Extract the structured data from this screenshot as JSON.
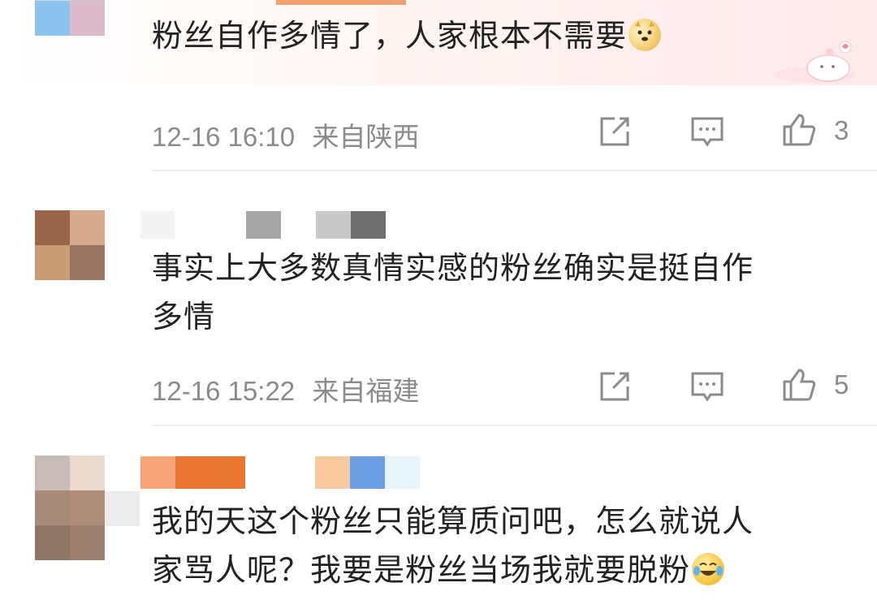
{
  "comments": [
    {
      "text": "粉丝自作多情了，人家根本不需要",
      "emoji": "doge-emoji",
      "time": "12-16 16:10",
      "location": "来自陕西",
      "likes": "3"
    },
    {
      "text_line1": "事实上大多数真情实感的粉丝确实是挺自作",
      "text_line2": "多情",
      "time": "12-16 15:22",
      "location": "来自福建",
      "likes": "5"
    },
    {
      "text_line1": "我的天这个粉丝只能算质问吧，怎么就说人",
      "text_line2": "家骂人呢？我要是粉丝当场我就要脱粉",
      "emoji": "laugh-cry-emoji"
    }
  ],
  "icons": {
    "share": "share-icon",
    "reply": "comment-icon",
    "like": "thumbs-up-icon"
  },
  "colors": {
    "text": "#222222",
    "meta": "#8b8b8b",
    "divider": "#efefef",
    "bubble_pink": "#ffe9ea"
  }
}
